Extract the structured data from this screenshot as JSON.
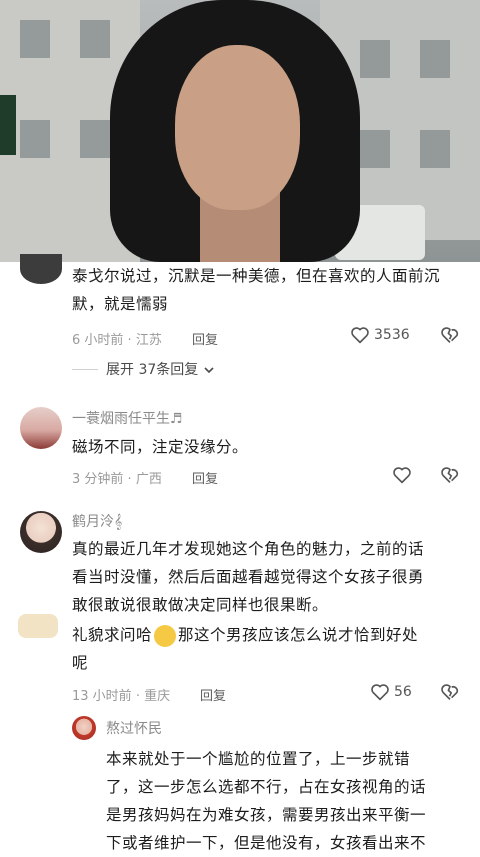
{
  "comments": [
    {
      "text": "泰戈尔说过，沉默是一种美德，但在喜欢的人面前沉默，就是懦弱",
      "time": "6 小时前",
      "location": "江苏",
      "reply_label": "回复",
      "likes": "3536",
      "expand_label": "展开 37条回复"
    },
    {
      "username": "一蓑烟雨任平生♬",
      "text": "磁场不同，注定没缘分。",
      "time": "3 分钟前",
      "location": "广西",
      "reply_label": "回复"
    },
    {
      "username": "鹤月泠",
      "text_line1": "真的最近几年才发现她这个角色的魅力，之前的话",
      "text_line2": "看当时没懂，然后后面越看越觉得这个女孩子很勇",
      "text_line3": "敢很敢说很敢做决定同样也很果断。",
      "text_line4a": "礼貌求问哈",
      "text_line4b": "那这个男孩应该怎么说才恰到好处",
      "text_line5": "呢",
      "time": "13 小时前",
      "location": "重庆",
      "reply_label": "回复",
      "likes": "56"
    },
    {
      "username": "熬过怀民",
      "text_line1": "本来就处于一个尴尬的位置了，上一步就错",
      "text_line2": "了，这一步怎么选都不行，占在女孩视角的话",
      "text_line3": "是男孩妈妈在为难女孩，需要男孩出来平衡一",
      "text_line4": "下或者维护一下，但是他没有，女孩看出来不"
    }
  ],
  "meta_separator": "·"
}
